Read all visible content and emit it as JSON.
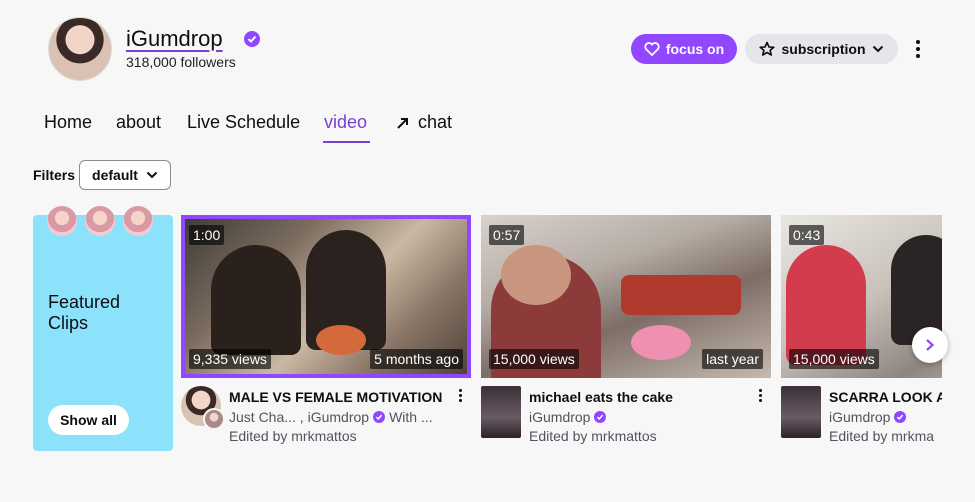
{
  "channel": {
    "name": "iGumdrop",
    "followers": "318,000 followers"
  },
  "actions": {
    "focus_label": "focus on",
    "subscription_label": "subscription"
  },
  "tabs": [
    {
      "label": "Home"
    },
    {
      "label": "about"
    },
    {
      "label": "Live Schedule"
    },
    {
      "label": "video",
      "active": true
    },
    {
      "label": "chat"
    }
  ],
  "filters": {
    "label": "Filters",
    "selected": "default"
  },
  "featured_clips": {
    "title": "Featured Clips",
    "button": "Show all"
  },
  "videos": [
    {
      "duration": "1:00",
      "views": "9,335 views",
      "age": "5 months ago",
      "title": "MALE VS FEMALE MOTIVATION",
      "channels": "Just Cha... , iGumdrop",
      "channels_suffix": "With  ...",
      "edited_by": "Edited by mrkmattos"
    },
    {
      "duration": "0:57",
      "views": "15,000 views",
      "age": "last year",
      "title": "michael eats the cake",
      "channels": "iGumdrop",
      "channels_suffix": "",
      "edited_by": "Edited by mrkmattos"
    },
    {
      "duration": "0:43",
      "views": "15,000 views",
      "age": "",
      "title": "SCARRA LOOK A",
      "channels": "iGumdrop",
      "channels_suffix": "",
      "edited_by": "Edited by mrkma"
    }
  ],
  "colors": {
    "accent": "#9147ff",
    "link": "#7a3fd1",
    "featured_bg": "#8ce1fb"
  }
}
